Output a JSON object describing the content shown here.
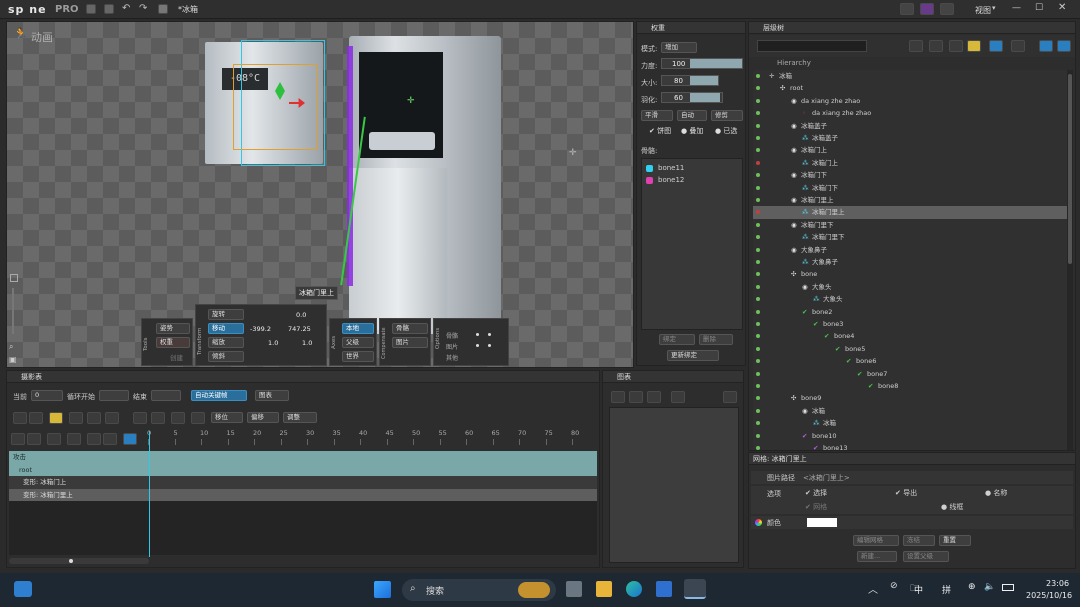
{
  "app": {
    "logo": "sp ne",
    "logo_suffix": "PRO",
    "file_name": "*冰箱",
    "view_label": "视图"
  },
  "viewport": {
    "mode_label": "动画",
    "bone_tooltip": "冰箱门里上"
  },
  "tools": {
    "label": "Tools",
    "pose": "姿势",
    "weights": "权重",
    "create": "创建"
  },
  "transform": {
    "label": "Transform",
    "rotate": "旋转",
    "rotate_value": "0.0",
    "translate": "移动",
    "tx": "-399.2",
    "ty": "747.25",
    "scale": "缩放",
    "sx": "1.0",
    "sy": "1.0",
    "shear": "倾斜"
  },
  "axes": {
    "label": "Axes",
    "local": "本地",
    "parent": "父级",
    "world": "世界"
  },
  "compensate": {
    "label": "Compensate",
    "bones": "骨骼",
    "images": "图片"
  },
  "options": {
    "label": "Options",
    "rows": [
      "骨骼",
      "图片",
      "其他"
    ]
  },
  "weights_panel": {
    "title": "权重",
    "mode_label": "模式:",
    "mode_value": "增加",
    "strength_label": "力度:",
    "strength_value": "100",
    "size_label": "大小:",
    "size_value": "80",
    "feather_label": "羽化:",
    "feather_value": "60",
    "smooth": "平滑",
    "auto": "自动",
    "prune": "修剪",
    "overlay": "饼图",
    "stack": "叠加",
    "selected": "已选",
    "bones_label": "骨骼:",
    "bones": [
      {
        "name": "bone11",
        "color": "#2fd0f0"
      },
      {
        "name": "bone12",
        "color": "#e040b0"
      }
    ],
    "bind": "绑定",
    "remove": "删除",
    "update_binding": "更新绑定"
  },
  "tree_panel": {
    "title": "层级树",
    "search_placeholder": "",
    "hierarchy_label": "Hierarchy",
    "rows": [
      {
        "depth": 0,
        "icon": "skeleton",
        "text": "冰箱",
        "eye": "green"
      },
      {
        "depth": 1,
        "icon": "bone",
        "text": "root",
        "eye": "green"
      },
      {
        "depth": 2,
        "icon": "slot",
        "text": "da xiang zhe zhao",
        "eye": "green"
      },
      {
        "depth": 3,
        "icon": "attach",
        "text": "da xiang zhe zhao",
        "eye": "green"
      },
      {
        "depth": 2,
        "icon": "slot",
        "text": "冰箱盖子",
        "eye": "green"
      },
      {
        "depth": 3,
        "icon": "mesh",
        "text": "冰箱盖子",
        "eye": "green"
      },
      {
        "depth": 2,
        "icon": "slot",
        "text": "冰箱门上",
        "eye": "green"
      },
      {
        "depth": 3,
        "icon": "mesh",
        "text": "冰箱门上",
        "eye": "red"
      },
      {
        "depth": 2,
        "icon": "slot",
        "text": "冰箱门下",
        "eye": "green"
      },
      {
        "depth": 3,
        "icon": "mesh",
        "text": "冰箱门下",
        "eye": "green"
      },
      {
        "depth": 2,
        "icon": "slot",
        "text": "冰箱门里上",
        "eye": "green"
      },
      {
        "depth": 3,
        "icon": "mesh",
        "text": "冰箱门里上",
        "eye": "red",
        "selected": true
      },
      {
        "depth": 2,
        "icon": "slot",
        "text": "冰箱门里下",
        "eye": "green"
      },
      {
        "depth": 3,
        "icon": "mesh",
        "text": "冰箱门里下",
        "eye": "green"
      },
      {
        "depth": 2,
        "icon": "slot",
        "text": "大象鼻子",
        "eye": "green"
      },
      {
        "depth": 3,
        "icon": "mesh",
        "text": "大象鼻子",
        "eye": "green"
      },
      {
        "depth": 2,
        "icon": "bone",
        "text": "bone",
        "eye": "green"
      },
      {
        "depth": 3,
        "icon": "slot",
        "text": "大象头",
        "eye": "green"
      },
      {
        "depth": 4,
        "icon": "mesh",
        "text": "大象头",
        "eye": "green"
      },
      {
        "depth": 3,
        "icon": "bonegreen",
        "text": "bone2",
        "eye": "green"
      },
      {
        "depth": 4,
        "icon": "bonegreen",
        "text": "bone3",
        "eye": "green"
      },
      {
        "depth": 5,
        "icon": "bonegreen",
        "text": "bone4",
        "eye": "green"
      },
      {
        "depth": 6,
        "icon": "bonegreen",
        "text": "bone5",
        "eye": "green"
      },
      {
        "depth": 7,
        "icon": "bonegreen",
        "text": "bone6",
        "eye": "green"
      },
      {
        "depth": 8,
        "icon": "bonegreen",
        "text": "bone7",
        "eye": "green"
      },
      {
        "depth": 9,
        "icon": "bonegreen",
        "text": "bone8",
        "eye": "green"
      },
      {
        "depth": 2,
        "icon": "bone",
        "text": "bone9",
        "eye": "green"
      },
      {
        "depth": 3,
        "icon": "slot",
        "text": "冰箱",
        "eye": "green"
      },
      {
        "depth": 4,
        "icon": "mesh",
        "text": "冰箱",
        "eye": "green"
      },
      {
        "depth": 3,
        "icon": "bonepurple",
        "text": "bone10",
        "eye": "green"
      },
      {
        "depth": 4,
        "icon": "bonepurple",
        "text": "bone13",
        "eye": "green"
      }
    ]
  },
  "mesh_props": {
    "title": "网格: 冰箱门里上",
    "image_path_label": "图片路径",
    "image_path_value": "<冰箱门里上>",
    "options_label": "选项",
    "select": "选择",
    "export": "导出",
    "name": "名称",
    "mesh": "网格",
    "wireframe": "线框",
    "color_label": "颜色",
    "edit_mesh": "编辑网格",
    "freeze": "冻结",
    "reset": "重置",
    "new": "新建...",
    "set_parent": "设置父级"
  },
  "dopesheet": {
    "title": "摄影表",
    "current_label": "当前",
    "current_value": "0",
    "loop_start": "循环开始",
    "end_label": "结束",
    "auto_key": "自动关键帧",
    "graph": "图表",
    "offset": "移位",
    "shift": "偏移",
    "adjust": "调整",
    "ruler": [
      "0",
      "5",
      "10",
      "15",
      "20",
      "25",
      "30",
      "35",
      "40",
      "45",
      "50",
      "55",
      "60",
      "65",
      "70",
      "75",
      "80"
    ],
    "tracks": [
      "攻击",
      "root",
      "变形: 冰箱门上",
      "变形: 冰箱门里上"
    ]
  },
  "graph_panel": {
    "title": "图表"
  },
  "taskbar": {
    "search": "搜索",
    "time": "23:06",
    "date": "2025/10/16",
    "ime1": "中",
    "ime2": "拼"
  }
}
